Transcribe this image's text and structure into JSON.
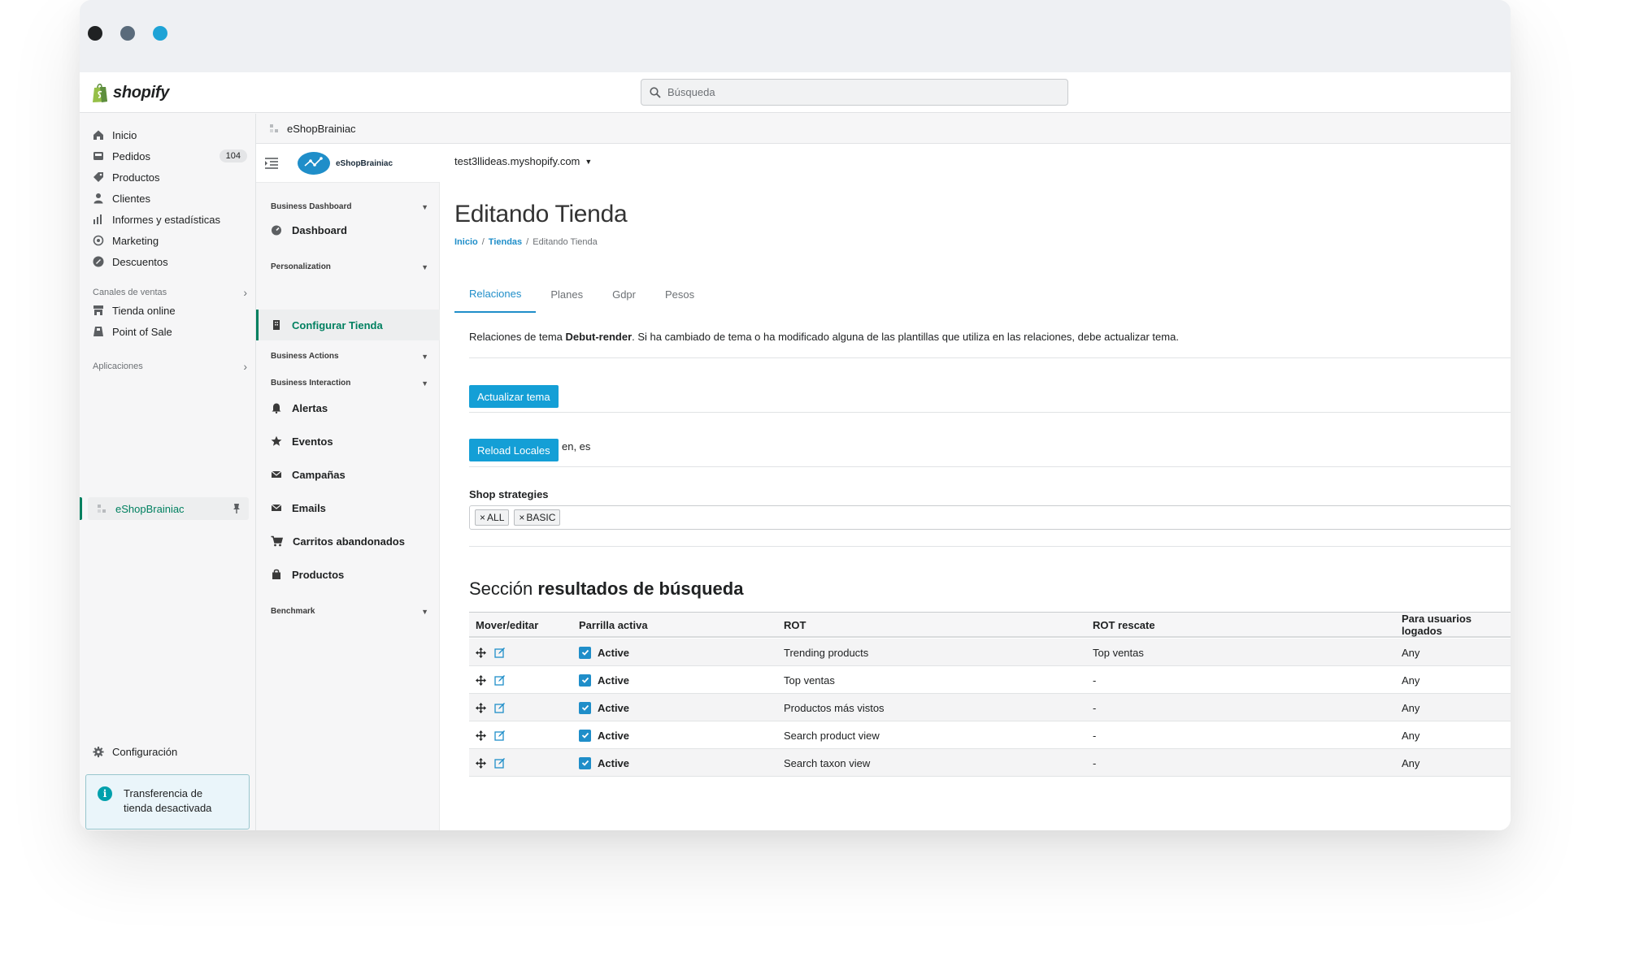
{
  "brand": {
    "name": "shopify"
  },
  "search": {
    "placeholder": "Búsqueda"
  },
  "sidebar": {
    "items": [
      {
        "label": "Inicio",
        "icon": "home-icon"
      },
      {
        "label": "Pedidos",
        "icon": "orders-icon",
        "badge": "104"
      },
      {
        "label": "Productos",
        "icon": "tag-icon"
      },
      {
        "label": "Clientes",
        "icon": "person-icon"
      },
      {
        "label": "Informes y estadísticas",
        "icon": "bar-chart-icon"
      },
      {
        "label": "Marketing",
        "icon": "target-icon"
      },
      {
        "label": "Descuentos",
        "icon": "discount-icon"
      }
    ],
    "sales_channels": {
      "label": "Canales de ventas",
      "items": [
        {
          "label": "Tienda online",
          "icon": "store-icon"
        },
        {
          "label": "Point of Sale",
          "icon": "pos-icon"
        }
      ]
    },
    "apps": {
      "label": "Aplicaciones",
      "items": [
        {
          "label": "eShopBrainiac",
          "icon": "app-icon"
        }
      ]
    },
    "settings": {
      "label": "Configuración",
      "icon": "gear-icon"
    },
    "notice": {
      "line1": "Transferencia de",
      "line2": "tienda desactivada"
    }
  },
  "app": {
    "header_title": "eShopBrainiac",
    "logo_text": "eShopBrainiac",
    "menu": {
      "groups": [
        {
          "label": "Business Dashboard"
        },
        {
          "label": "Personalization"
        },
        {
          "label": "Business Actions"
        },
        {
          "label": "Business Interaction"
        },
        {
          "label": "Benchmark"
        }
      ],
      "items": [
        {
          "label": "Dashboard",
          "icon": "dashboard-icon"
        },
        {
          "label": "Configurar Tienda",
          "icon": "building-icon"
        },
        {
          "label": "Alertas",
          "icon": "bell-icon"
        },
        {
          "label": "Eventos",
          "icon": "star-icon"
        },
        {
          "label": "Campañas",
          "icon": "envelope-icon"
        },
        {
          "label": "Emails",
          "icon": "envelope-icon"
        },
        {
          "label": "Carritos abandonados",
          "icon": "cart-icon"
        },
        {
          "label": "Productos",
          "icon": "bag-icon"
        }
      ]
    }
  },
  "content": {
    "store_url": "test3llideas.myshopify.com",
    "title": "Editando Tienda",
    "breadcrumb": {
      "home": "Inicio",
      "stores": "Tiendas",
      "current": "Editando Tienda",
      "sep": "/"
    },
    "tabs": [
      "Relaciones",
      "Planes",
      "Gdpr",
      "Pesos"
    ],
    "description": {
      "prefix": "Relaciones de tema ",
      "theme": "Debut-render",
      "suffix": ". Si ha cambiado de tema o ha modificado alguna de las plantillas que utiliza en las relaciones, debe actualizar tema."
    },
    "update_theme_button": "Actualizar tema",
    "reload_locales_button": "Reload Locales",
    "locales": "en, es",
    "shop_strategies": {
      "label": "Shop strategies",
      "tags": [
        "ALL",
        "BASIC"
      ],
      "remove_glyph": "×"
    },
    "section": {
      "title_prefix": "Sección ",
      "title_bold": "resultados de búsqueda"
    },
    "table": {
      "headers": [
        "Mover/editar",
        "Parrilla activa",
        "ROT",
        "ROT rescate",
        "Para usuarios logados"
      ],
      "rows": [
        {
          "active": "Active",
          "rot": "Trending products",
          "rescue": "Top ventas",
          "users": "Any"
        },
        {
          "active": "Active",
          "rot": "Top ventas",
          "rescue": "-",
          "users": "Any"
        },
        {
          "active": "Active",
          "rot": "Productos más vistos",
          "rescue": "-",
          "users": "Any"
        },
        {
          "active": "Active",
          "rot": "Search product view",
          "rescue": "-",
          "users": "Any"
        },
        {
          "active": "Active",
          "rot": "Search taxon view",
          "rescue": "-",
          "users": "Any"
        }
      ]
    }
  },
  "colors": {
    "accent": "#1f8ec9",
    "brand_green": "#008060",
    "button": "#149fd6",
    "dot_1": "#202223",
    "dot_2": "#5a6b7b",
    "dot_3": "#1ea3d6"
  }
}
